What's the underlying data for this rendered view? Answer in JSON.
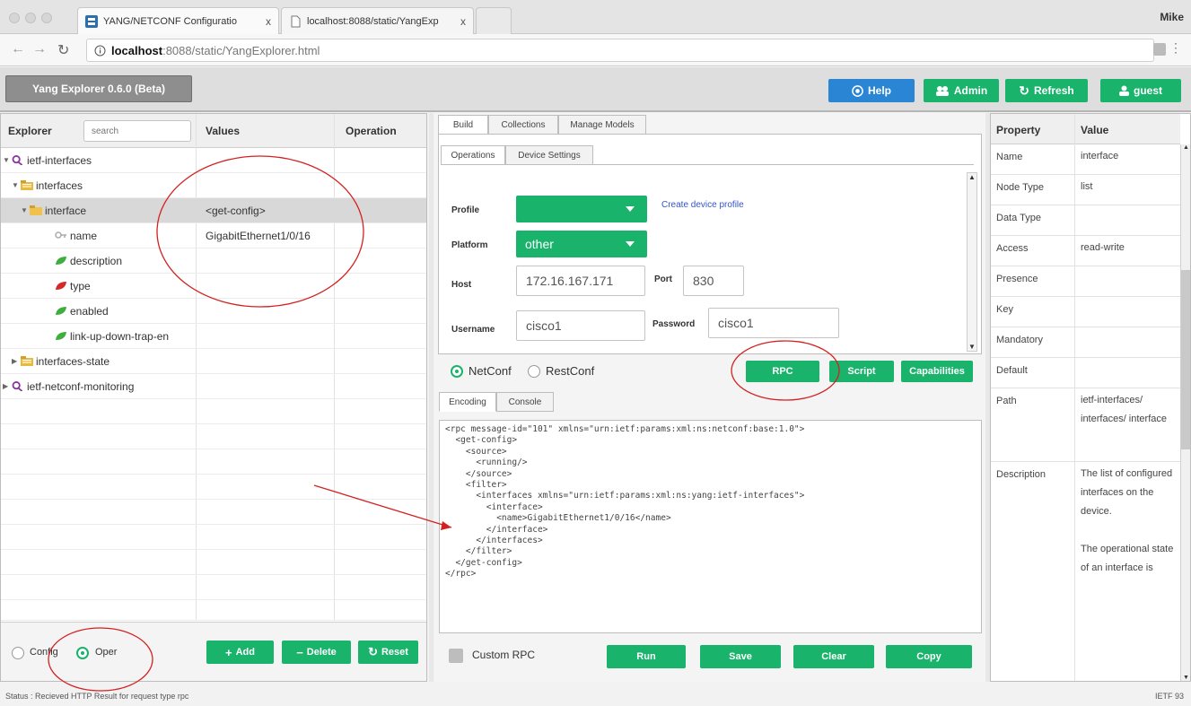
{
  "browser": {
    "user": "Mike",
    "tabs": [
      {
        "label": "YANG/NETCONF Configuratio",
        "close": "x"
      },
      {
        "label": "localhost:8088/static/YangExp",
        "close": "x"
      }
    ],
    "url_host": "localhost",
    "url_rest": ":8088/static/YangExplorer.html"
  },
  "app": {
    "title": "Yang Explorer 0.6.0 (Beta)",
    "buttons": {
      "help": "Help",
      "admin": "Admin",
      "refresh": "Refresh",
      "guest": "guest"
    }
  },
  "explorer": {
    "header": {
      "explorer": "Explorer",
      "search_placeholder": "search",
      "values": "Values",
      "operation": "Operation"
    },
    "rows": [
      {
        "label": "ietf-interfaces",
        "value": ""
      },
      {
        "label": "interfaces",
        "value": ""
      },
      {
        "label": "interface",
        "value": "<get-config>"
      },
      {
        "label": "name",
        "value": "GigabitEthernet1/0/16"
      },
      {
        "label": "description",
        "value": ""
      },
      {
        "label": "type",
        "value": ""
      },
      {
        "label": "enabled",
        "value": ""
      },
      {
        "label": "link-up-down-trap-en",
        "value": ""
      },
      {
        "label": "interfaces-state",
        "value": ""
      },
      {
        "label": "ietf-netconf-monitoring",
        "value": ""
      }
    ],
    "mode": {
      "config": "Config",
      "oper": "Oper",
      "selected": "Oper"
    },
    "actions": {
      "add": "Add",
      "delete": "Delete",
      "reset": "Reset"
    }
  },
  "center": {
    "tabs": [
      "Build",
      "Collections",
      "Manage Models"
    ],
    "subtabs": [
      "Operations",
      "Device Settings"
    ],
    "form": {
      "profile_label": "Profile",
      "profile_value": "",
      "create_profile_link": "Create device profile",
      "platform_label": "Platform",
      "platform_value": "other",
      "host_label": "Host",
      "host_value": "172.16.167.171",
      "port_label": "Port",
      "port_value": "830",
      "username_label": "Username",
      "username_value": "cisco1",
      "password_label": "Password",
      "password_value": "cisco1"
    },
    "protocol": {
      "netconf": "NetConf",
      "restconf": "RestConf",
      "selected": "NetConf"
    },
    "buttons": {
      "rpc": "RPC",
      "script": "Script",
      "capabilities": "Capabilities"
    },
    "output_tabs": [
      "Encoding",
      "Console"
    ],
    "xml": "<rpc message-id=\"101\" xmlns=\"urn:ietf:params:xml:ns:netconf:base:1.0\">\n  <get-config>\n    <source>\n      <running/>\n    </source>\n    <filter>\n      <interfaces xmlns=\"urn:ietf:params:xml:ns:yang:ietf-interfaces\">\n        <interface>\n          <name>GigabitEthernet1/0/16</name>\n        </interface>\n      </interfaces>\n    </filter>\n  </get-config>\n</rpc>",
    "bottom": {
      "custom_rpc": "Custom RPC",
      "run": "Run",
      "save": "Save",
      "clear": "Clear",
      "copy": "Copy"
    }
  },
  "properties": {
    "header": {
      "property": "Property",
      "value": "Value"
    },
    "rows": [
      {
        "key": "Name",
        "value": "interface"
      },
      {
        "key": "Node Type",
        "value": "list"
      },
      {
        "key": "Data Type",
        "value": ""
      },
      {
        "key": "Access",
        "value": "read-write"
      },
      {
        "key": "Presence",
        "value": ""
      },
      {
        "key": "Key",
        "value": ""
      },
      {
        "key": "Mandatory",
        "value": ""
      },
      {
        "key": "Default",
        "value": ""
      },
      {
        "key": "Path",
        "value": "ietf-interfaces/ interfaces/ interface"
      },
      {
        "key": "Description",
        "value": "The list of configured interfaces on the device.\n\nThe operational state of an interface is"
      }
    ]
  },
  "status": {
    "message": "Status : Recieved HTTP Result for request type rpc",
    "right": "IETF 93"
  },
  "colors": {
    "accent_green": "#19b36b",
    "accent_blue": "#2a86d4",
    "annotation_red": "#d32020"
  }
}
